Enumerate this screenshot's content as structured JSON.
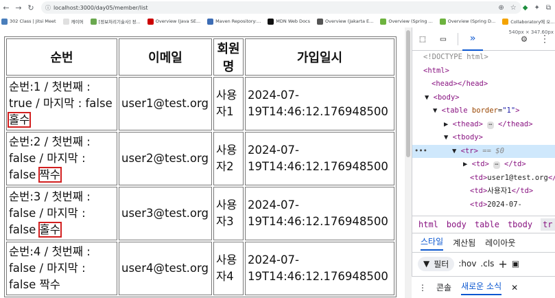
{
  "browser": {
    "url": "localhost:3000/day05/member/list",
    "bookmarks": [
      {
        "label": "302 Class | Jitsi Meet",
        "color": "#4a7ebb"
      },
      {
        "label": "캐이머",
        "color": "#e0e0e0"
      },
      {
        "label": "[정보처리기술사] 정...",
        "color": "#6aa84f"
      },
      {
        "label": "Overview (Java SE...",
        "color": "#cc0000"
      },
      {
        "label": "Maven Repository:...",
        "color": "#3d6db5"
      },
      {
        "label": "MDN Web Docs",
        "color": "#111111"
      },
      {
        "label": "Overview (Jakarta E...",
        "color": "#555555"
      },
      {
        "label": "Overview (Spring ...",
        "color": "#6db33f"
      },
      {
        "label": "Overview (Spring D...",
        "color": "#6db33f"
      },
      {
        "label": "Collaboratory에 오...",
        "color": "#f4a300"
      }
    ],
    "size_indicator": "540px × 347.60px"
  },
  "table": {
    "headers": [
      "순번",
      "이메일",
      "회원명",
      "가입일시"
    ],
    "rows": [
      {
        "index": "순번:1 / 첫번째 : true / 마지막 : false",
        "parity": "홀수",
        "email": "user1@test.org",
        "name": "사용자1",
        "joined": "2024-07-19T14:46:12.176948500"
      },
      {
        "index": "순번:2 / 첫번째 : false / 마지막 : false",
        "parity": "짝수",
        "email": "user2@test.org",
        "name": "사용자2",
        "joined": "2024-07-19T14:46:12.176948500"
      },
      {
        "index": "순번:3 / 첫번째 : false / 마지막 : false",
        "parity": "홀수",
        "email": "user3@test.org",
        "name": "사용자3",
        "joined": "2024-07-19T14:46:12.176948500"
      },
      {
        "index": "순번:4 / 첫번째 : false / 마지막 : false",
        "parity": "짝수",
        "email": "user4@test.org",
        "name": "사용자4",
        "joined": "2024-07-19T14:46:12.176948500"
      }
    ]
  },
  "devtools": {
    "dom": {
      "doctype": "<!DOCTYPE html>",
      "html_open": "<html>",
      "head": "<head></head>",
      "body_open": "<body>",
      "table_tag": "table",
      "table_attr": "border",
      "table_attr_val": "\"1\"",
      "thead": "thead",
      "tbody": "tbody",
      "tr": "tr",
      "tr_marker": "== $0",
      "td": "td",
      "td_email": "user1@test.org",
      "td_name": "사용자1",
      "td_date_partial": "2024-07-"
    },
    "crumbs": [
      "html",
      "body",
      "table",
      "tbody",
      "tr"
    ],
    "sub_tabs": [
      "스타일",
      "계산됨",
      "레이아웃"
    ],
    "filter_label": "필터",
    "filter_hov": ":hov",
    "filter_cls": ".cls",
    "drawer_tabs": [
      "콘솔",
      "새로운 소식"
    ]
  }
}
